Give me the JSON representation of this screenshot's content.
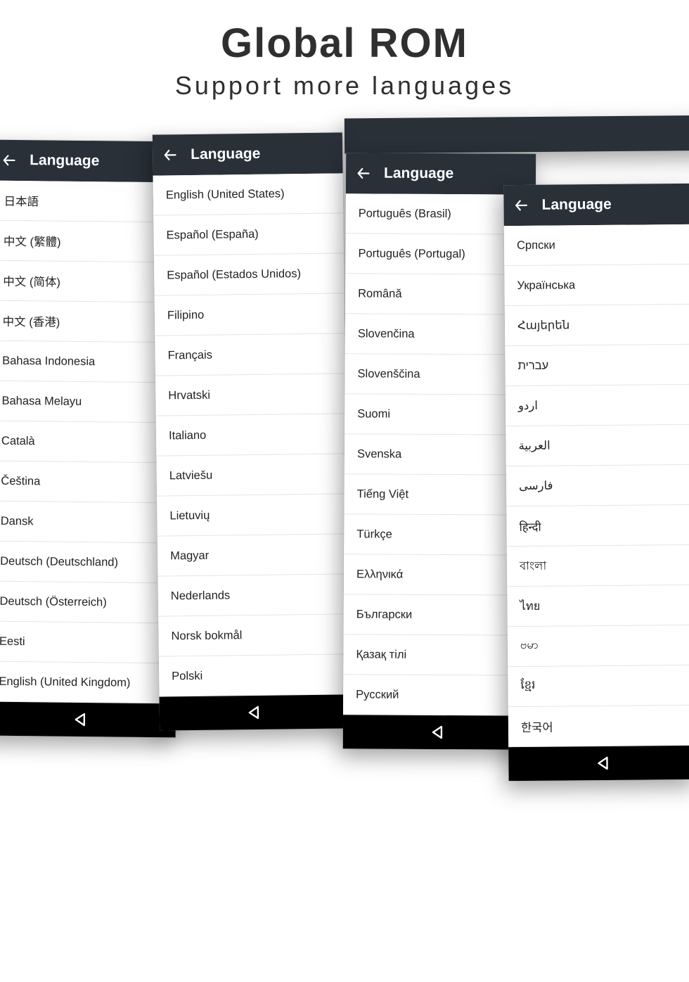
{
  "hero": {
    "title": "Global ROM",
    "subtitle": "Support more languages"
  },
  "common": {
    "appbar_title": "Language"
  },
  "phones": [
    {
      "id": "p1",
      "items": [
        "日本語",
        "中文 (繁體)",
        "中文 (简体)",
        "中文 (香港)",
        "Bahasa Indonesia",
        "Bahasa Melayu",
        "Català",
        "Čeština",
        "Dansk",
        "Deutsch (Deutschland)",
        "Deutsch (Österreich)",
        "Eesti",
        "English (United Kingdom)"
      ]
    },
    {
      "id": "p2",
      "items": [
        "English (United States)",
        "Español (España)",
        "Español (Estados Unidos)",
        "Filipino",
        "Français",
        "Hrvatski",
        "Italiano",
        "Latviešu",
        "Lietuvių",
        "Magyar",
        "Nederlands",
        "Norsk bokmål",
        "Polski"
      ]
    },
    {
      "id": "p3",
      "items": [
        "Português (Brasil)",
        "Português (Portugal)",
        "Română",
        "Slovenčina",
        "Slovenščina",
        "Suomi",
        "Svenska",
        "Tiếng Việt",
        "Türkçe",
        "Ελληνικά",
        "Български",
        "Қазақ тілі",
        "Русский"
      ]
    },
    {
      "id": "p4",
      "items": [
        "Српски",
        "Українська",
        "Հայերեն",
        "עברית",
        "اردو",
        "العربية",
        "فارسی",
        "हिन्दी",
        "বাংলা",
        "ไทย",
        "ဗမာ",
        "ខ្មែរ",
        "한국어"
      ]
    }
  ]
}
